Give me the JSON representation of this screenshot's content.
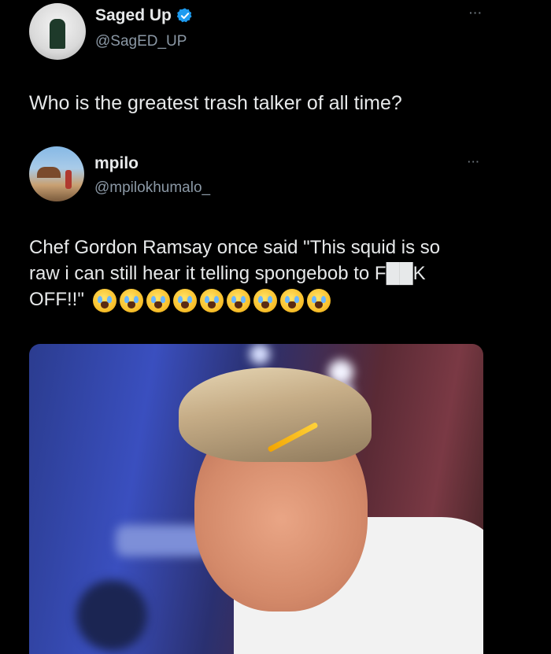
{
  "outer_tweet": {
    "display_name": "Saged Up",
    "handle": "@SagED_UP",
    "verified": true,
    "more_icon": "more-horizontal-icon",
    "text": "Who is the greatest trash talker of all time?"
  },
  "quoted_tweet": {
    "display_name": "mpilo",
    "handle": "@mpilokhumalo_",
    "more_icon": "more-horizontal-icon",
    "text_line1": "Chef Gordon Ramsay once said \"This squid is so",
    "text_line2": "raw i can still hear it telling spongebob to F██K",
    "text_line3": "OFF!!\"",
    "emoji_count": 9,
    "emoji_name": "loudly-crying-face"
  },
  "colors": {
    "background": "#000000",
    "text": "#e7e9ea",
    "muted": "#8b98a5",
    "verified": "#1d9bf0"
  }
}
